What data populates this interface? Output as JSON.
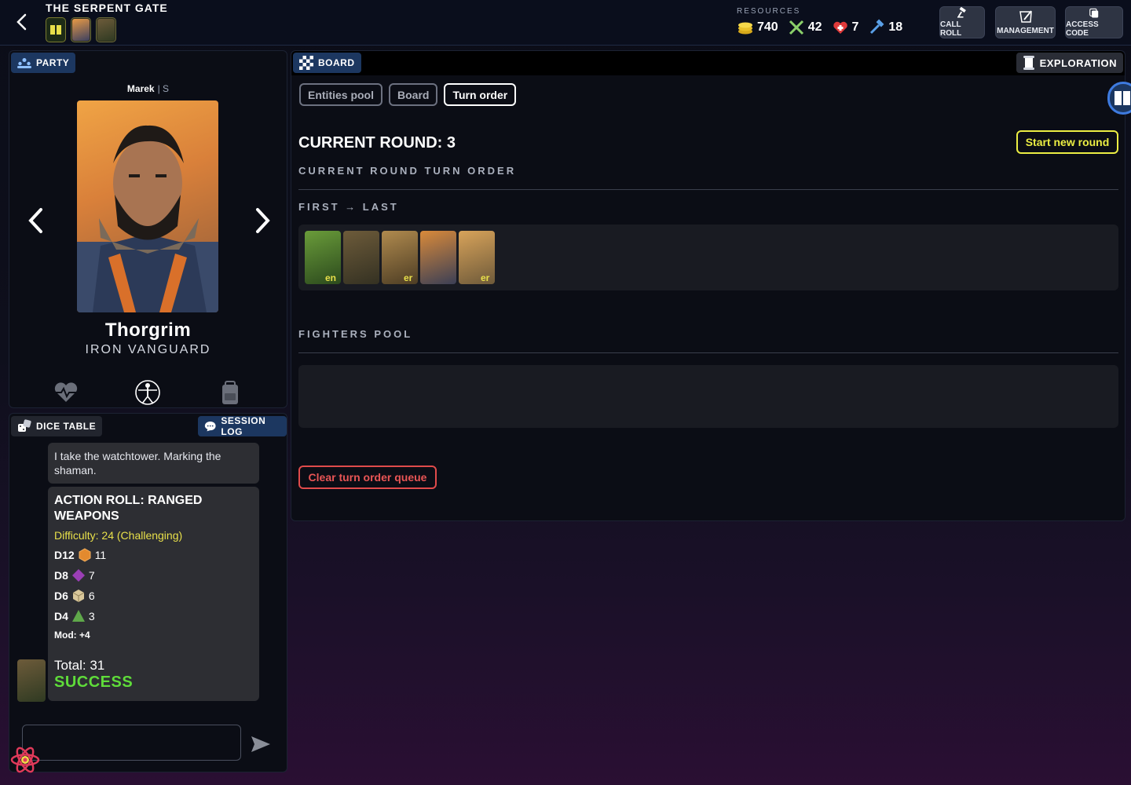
{
  "header": {
    "campaign_title": "THE SERPENT GATE",
    "resources_label": "RESOURCES",
    "resources": [
      {
        "icon": "coins-icon",
        "value": "740"
      },
      {
        "icon": "crossed-tools-icon",
        "value": "42"
      },
      {
        "icon": "heart-pot-icon",
        "value": "7"
      },
      {
        "icon": "hammer-icon",
        "value": "18"
      }
    ],
    "buttons": {
      "call_roll": "CALL ROLL",
      "management": "MANAGEMENT",
      "access_code": "ACCESS CODE"
    }
  },
  "party": {
    "tab_label": "PARTY",
    "player_name": "Marek",
    "player_tag": "| S",
    "character_name": "Thorgrim",
    "character_class": "IRON VANGUARD"
  },
  "dice_table": {
    "tab_label": "DICE TABLE",
    "log_label": "SESSION LOG",
    "message": "I take the watchtower. Marking the shaman.",
    "roll": {
      "title": "ACTION ROLL: RANGED WEAPONS",
      "difficulty": "Difficulty: 24 (Challenging)",
      "dice": [
        {
          "name": "D12",
          "value": "11",
          "color": "#e38a2e"
        },
        {
          "name": "D8",
          "value": "7",
          "color": "#9b3fb5"
        },
        {
          "name": "D6",
          "value": "6",
          "color": "#d9c79a"
        },
        {
          "name": "D4",
          "value": "3",
          "color": "#5fa84a"
        }
      ],
      "modifier": "Mod: +4",
      "total": "Total: 31",
      "result": "SUCCESS"
    },
    "input_value": ""
  },
  "board": {
    "tab_label": "BOARD",
    "mode_label": "EXPLORATION",
    "subtabs": [
      "Entities pool",
      "Board",
      "Turn order"
    ],
    "active_subtab": "Turn order",
    "round_title": "CURRENT ROUND: 3",
    "start_round_label": "Start new round",
    "turn_order_label": "CURRENT ROUND TURN ORDER",
    "direction_label": "FIRST → LAST",
    "turn_order": [
      {
        "tag": "en",
        "colors": [
          "#6a9c3a",
          "#2c4a1d"
        ]
      },
      {
        "tag": "",
        "colors": [
          "#6d5b3a",
          "#343122"
        ]
      },
      {
        "tag": "er",
        "colors": [
          "#b08a4e",
          "#4d3d24"
        ]
      },
      {
        "tag": "",
        "colors": [
          "#d98a3a",
          "#3b3f55"
        ]
      },
      {
        "tag": "er",
        "colors": [
          "#d8a35a",
          "#6e5a3a"
        ]
      }
    ],
    "fighters_pool_label": "FIGHTERS POOL",
    "clear_label": "Clear turn order queue"
  },
  "colors": {
    "accent_blue": "#1c3760",
    "warning_yellow": "#ecee43",
    "danger_red": "#e04b4b",
    "success_green": "#5fdc3a"
  }
}
